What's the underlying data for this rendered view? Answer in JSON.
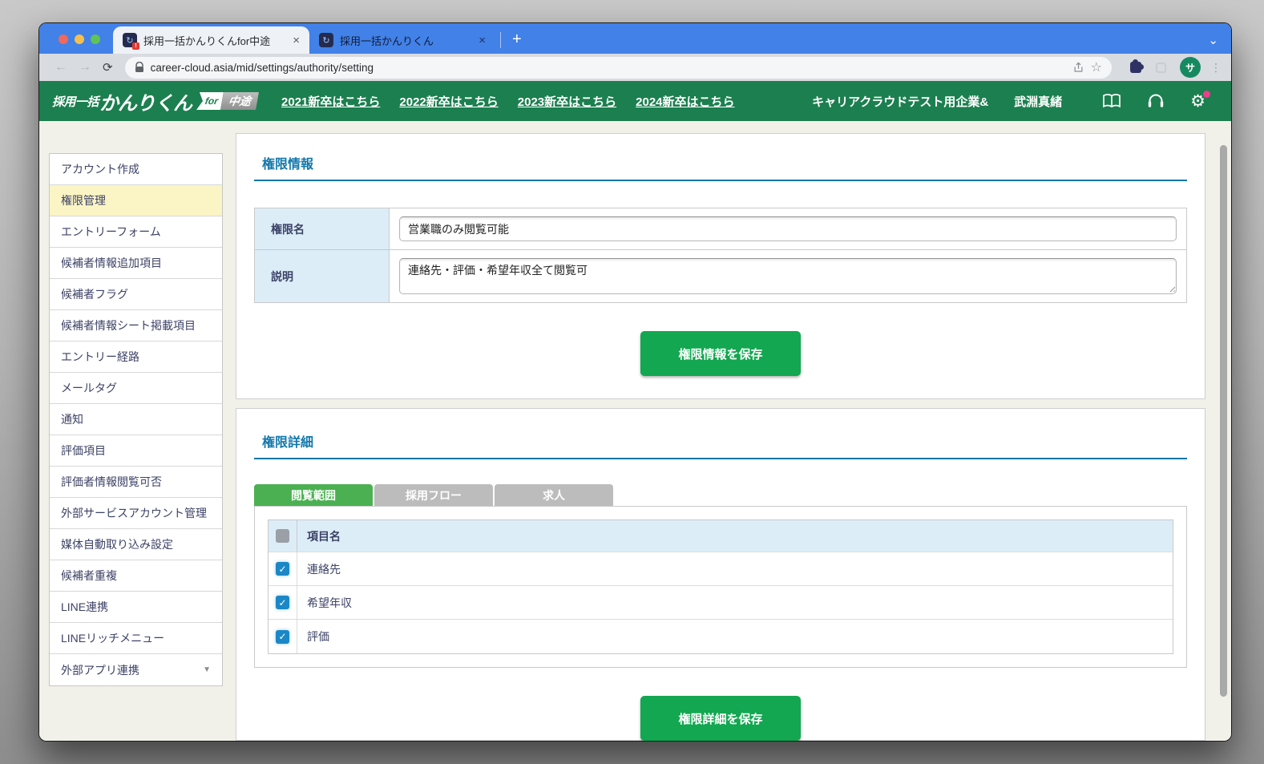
{
  "colors": {
    "chrome_blue": "#4181e8",
    "header_green": "#1c7f4f",
    "button_green": "#12a750",
    "active_tab_green": "#4bb052",
    "section_title_blue": "#1378ab",
    "checkbox_blue": "#1b87c6",
    "active_menu_yellow": "#fbf5c5",
    "label_cell_blue": "#dcedf8"
  },
  "browser": {
    "tabs": [
      {
        "title": "採用一括かんりくんfor中途",
        "active": true,
        "alert_badge": "!"
      },
      {
        "title": "採用一括かんりくん",
        "active": false
      }
    ],
    "favicon_glyph": "↻",
    "close_icon": "×",
    "new_tab_icon": "+",
    "tab_search_icon": "⌄",
    "back_icon": "←",
    "forward_icon": "→",
    "reload_icon": "⟳",
    "url": "career-cloud.asia/mid/settings/authority/setting",
    "star_icon": "☆",
    "more_icon": "⋮",
    "avatar_letter": "サ"
  },
  "app_header": {
    "logo_prefix": "採用一括",
    "logo_main": "かんりくん",
    "badge_for": "for",
    "badge_type": "中途",
    "nav_links": [
      "2021新卒はこちら",
      "2022新卒はこちら",
      "2023新卒はこちら",
      "2024新卒はこちら"
    ],
    "company_name": "キャリアクラウドテスト用企業&",
    "user_name": "武淵真緒",
    "gear_icon": "⚙"
  },
  "sidebar": {
    "dropdown_icon": "▼",
    "items": [
      {
        "label": "アカウント作成",
        "active": false
      },
      {
        "label": "権限管理",
        "active": true
      },
      {
        "label": "エントリーフォーム",
        "active": false
      },
      {
        "label": "候補者情報追加項目",
        "active": false
      },
      {
        "label": "候補者フラグ",
        "active": false
      },
      {
        "label": "候補者情報シート掲載項目",
        "active": false
      },
      {
        "label": "エントリー経路",
        "active": false
      },
      {
        "label": "メールタグ",
        "active": false
      },
      {
        "label": "通知",
        "active": false
      },
      {
        "label": "評価項目",
        "active": false
      },
      {
        "label": "評価者情報閲覧可否",
        "active": false
      },
      {
        "label": "外部サービスアカウント管理",
        "active": false
      },
      {
        "label": "媒体自動取り込み設定",
        "active": false
      },
      {
        "label": "候補者重複",
        "active": false
      },
      {
        "label": "LINE連携",
        "active": false
      },
      {
        "label": "LINEリッチメニュー",
        "active": false
      },
      {
        "label": "外部アプリ連携",
        "active": false,
        "has_dropdown": true
      }
    ]
  },
  "permission_info": {
    "section_title": "権限情報",
    "fields": [
      {
        "label": "権限名",
        "value": "営業職のみ閲覧可能",
        "type": "input"
      },
      {
        "label": "説明",
        "value": "連絡先・評価・希望年収全て閲覧可",
        "type": "textarea"
      }
    ],
    "save_button": "権限情報を保存"
  },
  "permission_detail": {
    "section_title": "権限詳細",
    "tabs": [
      {
        "label": "閲覧範囲",
        "active": true
      },
      {
        "label": "採用フロー",
        "active": false
      },
      {
        "label": "求人",
        "active": false
      }
    ],
    "table": {
      "header": "項目名",
      "check_icon": "✓",
      "rows": [
        {
          "label": "連絡先",
          "checked": true
        },
        {
          "label": "希望年収",
          "checked": true
        },
        {
          "label": "評価",
          "checked": true
        }
      ]
    },
    "save_button": "権限詳細を保存"
  }
}
